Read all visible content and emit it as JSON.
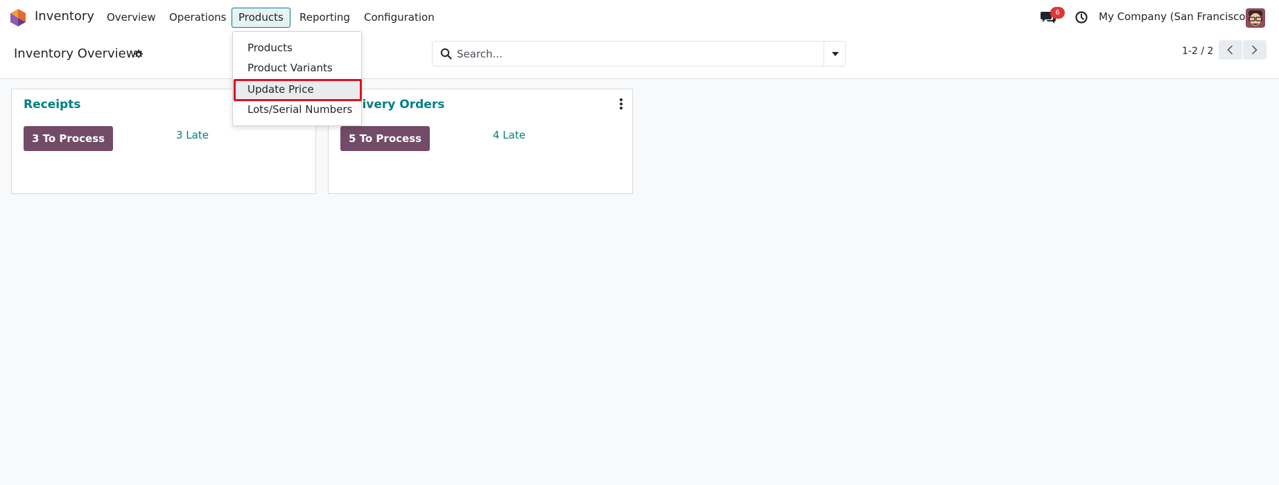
{
  "navbar": {
    "app_name": "Inventory",
    "menu": {
      "overview": "Overview",
      "operations": "Operations",
      "products": "Products",
      "reporting": "Reporting",
      "configuration": "Configuration"
    },
    "chat_count": "6",
    "company": "My Company (San Francisco)"
  },
  "products_menu": {
    "items": [
      "Products",
      "Product Variants",
      "Update Price",
      "Lots/Serial Numbers"
    ]
  },
  "control_panel": {
    "title": "Inventory Overview",
    "search_placeholder": "Search...",
    "pager": "1-2 / 2"
  },
  "cards": [
    {
      "title": "Receipts",
      "process_label": "3 To Process",
      "late_label": "3 Late"
    },
    {
      "title": "Delivery Orders",
      "process_label": "5 To Process",
      "late_label": "4 Late"
    }
  ],
  "colors": {
    "brand": "#714b67",
    "accent": "#017e84",
    "badge": "#e03535",
    "highlight": "#e0121a"
  },
  "icons": [
    "app-logo-icon",
    "chat-icon",
    "clock-icon",
    "gear-icon",
    "search-icon",
    "caret-down-icon",
    "chevron-left-icon",
    "chevron-right-icon",
    "kebab-icon"
  ]
}
